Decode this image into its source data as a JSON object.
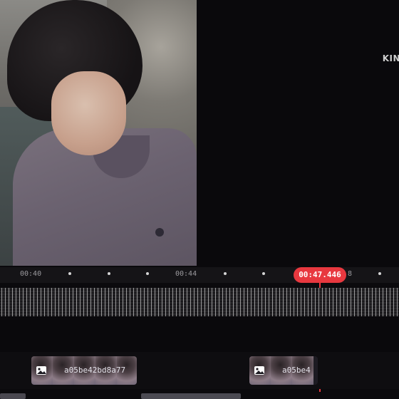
{
  "preview": {
    "overlay_text": "KIN"
  },
  "timeline": {
    "tick_labels": [
      "00:40",
      "00:44"
    ],
    "playhead_time": "00:47.446",
    "partial_tick_right": "8"
  },
  "clips": [
    {
      "name": "a05be42bd8a77"
    },
    {
      "name": "a05be4"
    }
  ],
  "colors": {
    "accent": "#e8383f",
    "background": "#0b0a0d"
  },
  "icons": [
    "image-icon"
  ]
}
